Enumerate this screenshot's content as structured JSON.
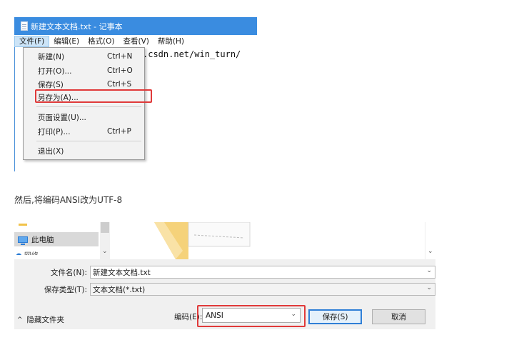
{
  "notepad": {
    "title": "新建文本文档.txt - 记事本",
    "menubar": [
      "文件(F)",
      "编辑(E)",
      "格式(O)",
      "查看(V)",
      "帮助(H)"
    ],
    "text_fragment": ".csdn.net/win_turn/",
    "file_menu": {
      "items": [
        {
          "label": "新建(N)",
          "shortcut": "Ctrl+N"
        },
        {
          "label": "打开(O)...",
          "shortcut": "Ctrl+O"
        },
        {
          "label": "保存(S)",
          "shortcut": "Ctrl+S"
        },
        {
          "label": "另存为(A)...",
          "shortcut": ""
        },
        {
          "label": "页面设置(U)...",
          "shortcut": ""
        },
        {
          "label": "打印(P)...",
          "shortcut": "Ctrl+P"
        },
        {
          "label": "退出(X)",
          "shortcut": ""
        }
      ],
      "highlighted": "另存为(A)..."
    }
  },
  "caption": "然后,将编码ANSI改为UTF-8",
  "save_dialog": {
    "nav_item": "此电脑",
    "nav_partial": "网络",
    "filename_label": "文件名(N):",
    "filename_value": "新建文本文档.txt",
    "filetype_label": "保存类型(T):",
    "filetype_value": "文本文档(*.txt)",
    "hide_folders": "隐藏文件夹",
    "encoding_label": "编码(E):",
    "encoding_value": "ANSI",
    "save_button": "保存(S)",
    "cancel_button": "取消"
  },
  "colors": {
    "accent": "#3a8ce0",
    "highlight_box": "#e03a3a"
  }
}
